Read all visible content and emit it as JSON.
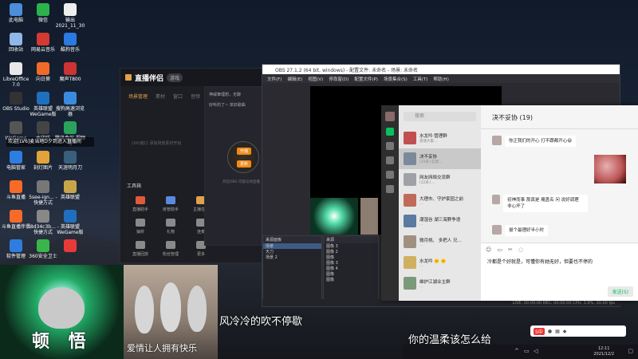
{
  "desktop": {
    "icons": [
      {
        "label": "此电脑",
        "color": "#4a8fd8"
      },
      {
        "label": "微信",
        "color": "#2bb24c"
      },
      {
        "label": "输出\n2021_11_30",
        "color": "#eeeeee"
      },
      {
        "label": "回收站",
        "color": "#8fb7e8"
      },
      {
        "label": "网易云音乐",
        "color": "#d33a31"
      },
      {
        "label": "酷狗音乐",
        "color": "#2a7ae2"
      },
      {
        "label": "LibreOffice 7.0",
        "color": "#e8e8e8"
      },
      {
        "label": "向日葵",
        "color": "#f06a2a"
      },
      {
        "label": "魔声T800",
        "color": "#cc3333"
      },
      {
        "label": "OBS Studio",
        "color": "#333333"
      },
      {
        "label": "英雄联盟 WeGame版",
        "color": "#1f6fbf"
      },
      {
        "label": "搜狗高速浏览器",
        "color": "#3a8be0"
      },
      {
        "label": "WeGame",
        "color": "#555555"
      },
      {
        "label": "水印坊",
        "color": "#444444"
      },
      {
        "label": "腾讯会议 视频号",
        "color": "#2aa25c"
      },
      {
        "label": "电脑管家",
        "color": "#2f7de0"
      },
      {
        "label": "刻灯图片",
        "color": "#e2a33a"
      },
      {
        "label": "天涯明月刀",
        "color": "#3a5f7a"
      },
      {
        "label": "斗鱼直播",
        "color": "#f86a28"
      },
      {
        "label": "5see-ign... - 快捷方式",
        "color": "#777777"
      },
      {
        "label": "英雄联盟",
        "color": "#c9a54a"
      },
      {
        "label": "斗鱼直播伴侣",
        "color": "#f86a28"
      },
      {
        "label": "18d34c3b... - 快捷方式",
        "color": "#888888"
      },
      {
        "label": "英雄联盟 WeGame版",
        "color": "#1f6fbf"
      },
      {
        "label": "软件管理",
        "color": "#2f7de0"
      },
      {
        "label": "360安全卫士",
        "color": "#39b54a"
      },
      {
        "label": "",
        "color": "#e83a3a"
      },
      {
        "label": "",
        "color": "#8a5ae8"
      }
    ]
  },
  "zhibo": {
    "title": "直播伴侣",
    "badge": "游戏",
    "tabs": [
      "场景管理",
      "素材",
      "窗口",
      "音频"
    ],
    "empty_text": "(XX)窗口 添加场景素材开始",
    "toolbox_label": "工具箱",
    "tools": [
      "直播助手",
      "房管助手",
      "主播任务",
      "抽奖",
      "礼物",
      "连麦",
      "直播回放",
      "粉丝管理",
      "更多"
    ],
    "right_panel": {
      "line1": "神威筆理想，无聊",
      "line2": "好听的了~ 单旧歌曲",
      "btn1": "开播",
      "btn2": "更新",
      "hint": "开启OBS 可能与你直播"
    }
  },
  "obs": {
    "title": "OBS 27.1.2 (64 bit, windows) - 配置文件: 未命名 - 场景: 未命名",
    "menu": [
      "文件(F)",
      "编辑(E)",
      "视图(V)",
      "停靠窗(D)",
      "配置文件(P)",
      "场景集合(S)",
      "工具(T)",
      "帮助(H)"
    ],
    "scenes_header": "来源面板",
    "scenes": [
      "场景",
      "天刀",
      "场景 2"
    ],
    "sources_header": "来源",
    "sources": [
      "图像 3",
      "图像 2",
      "图像",
      "图像 3",
      "图像 4",
      "图像",
      "图像"
    ],
    "status": "LIVE: 00:00:00   REC: 00:00:00   CPU: 3.8%, 30.00 fps"
  },
  "wechat": {
    "search_placeholder": "搜索",
    "chats": [
      {
        "name": "水龙吟·管理群",
        "sub": "恳请大家..."
      },
      {
        "name": "决不妥协",
        "sub": "[25条] 信息..."
      },
      {
        "name": "网友网络交流群",
        "sub": "[32条] ..."
      },
      {
        "name": "大理市、守护家园之前",
        "sub": "..."
      },
      {
        "name": "潮湿谷 湖三海野争语",
        "sub": "..."
      },
      {
        "name": "微月桃、 多把人 兄...",
        "sub": "..."
      },
      {
        "name": "水龙吟 🌞 🌞",
        "sub": "..."
      },
      {
        "name": "维护江湖业主群",
        "sub": "..."
      }
    ],
    "chat_title": "决不妥协 (19)",
    "messages": [
      {
        "text": "你正我们的开心 打不跟都开心😄",
        "side": "left"
      },
      {
        "text": "初神而事 那真是 掩盖名 问 说好调理 非心坏了",
        "side": "left"
      },
      {
        "text": "拔个最理好半小时",
        "side": "left"
      }
    ],
    "input_text": "冷都是个好就是，可懂你有她无好，但要也不停的",
    "send_label": "发送(S)"
  },
  "overlays": {
    "broadcast": "欢迎[LV6]麦当地D夕到进入直播间",
    "cat1_caption": "顿 悟",
    "cat2_caption": "爱情让人拥有快乐",
    "lyric1": "风冷冷的吹不停歇",
    "lyric2": "你的温柔该怎么给"
  },
  "taskbar": {
    "time": "12:11",
    "date": "2021/12/2",
    "ime_label": "S中"
  }
}
